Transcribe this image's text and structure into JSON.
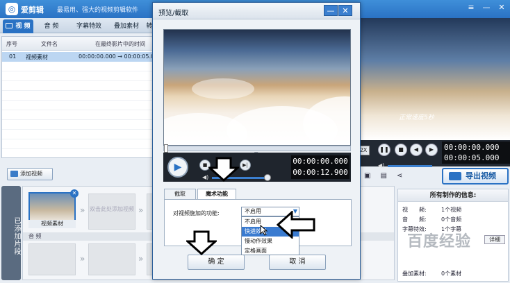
{
  "app": {
    "title": "爱剪辑",
    "subtitle": "最易用、强大的视频剪辑软件",
    "tabs": [
      "视 频",
      "音 频",
      "字幕特效",
      "叠加素材",
      "转"
    ]
  },
  "file_list": {
    "columns": [
      "序号",
      "文件名",
      "在最终影片中的时间"
    ],
    "rows": [
      {
        "index": "01",
        "name": "视频素材",
        "time": "00:00:00.000 → 00:00:05.0"
      }
    ]
  },
  "add_video_label": "添加视频",
  "clips": {
    "side_label": "已添加片段",
    "clip_name": "视频素材",
    "placeholder": "双击此处添加视频",
    "audio_label": "音 频"
  },
  "right": {
    "caption": "正常速度5秒",
    "time_top": "00:00:00.000",
    "time_bottom": "00:00:05.000",
    "speed_label": "2X",
    "export_label": "导出视频",
    "info_title": "所有制作的信息:",
    "info_rows": [
      {
        "k": "视　　频:",
        "v": "1个视频"
      },
      {
        "k": "音　　频:",
        "v": "0个音频"
      },
      {
        "k": "字幕特效:",
        "v": "1个字幕"
      },
      {
        "k": "叠加素材:",
        "v": "0个素材"
      }
    ],
    "detail_label": "详细",
    "watermark": "百度经验"
  },
  "dialog": {
    "title": "预览/截取",
    "time_current": "00:00:00.000",
    "time_total": "00:00:12.900",
    "progress_fraction": 0.0,
    "volume_fraction": 0.85,
    "tabs": [
      "截取",
      "魔术功能"
    ],
    "active_tab": 1,
    "field_label": "对视频施加的功能:",
    "select_value": "不启用",
    "options": [
      "不启用",
      "快进效果",
      "慢动作效果",
      "定格画面"
    ],
    "highlighted_option": 1,
    "ok_label": "确 定",
    "cancel_label": "取 消"
  }
}
